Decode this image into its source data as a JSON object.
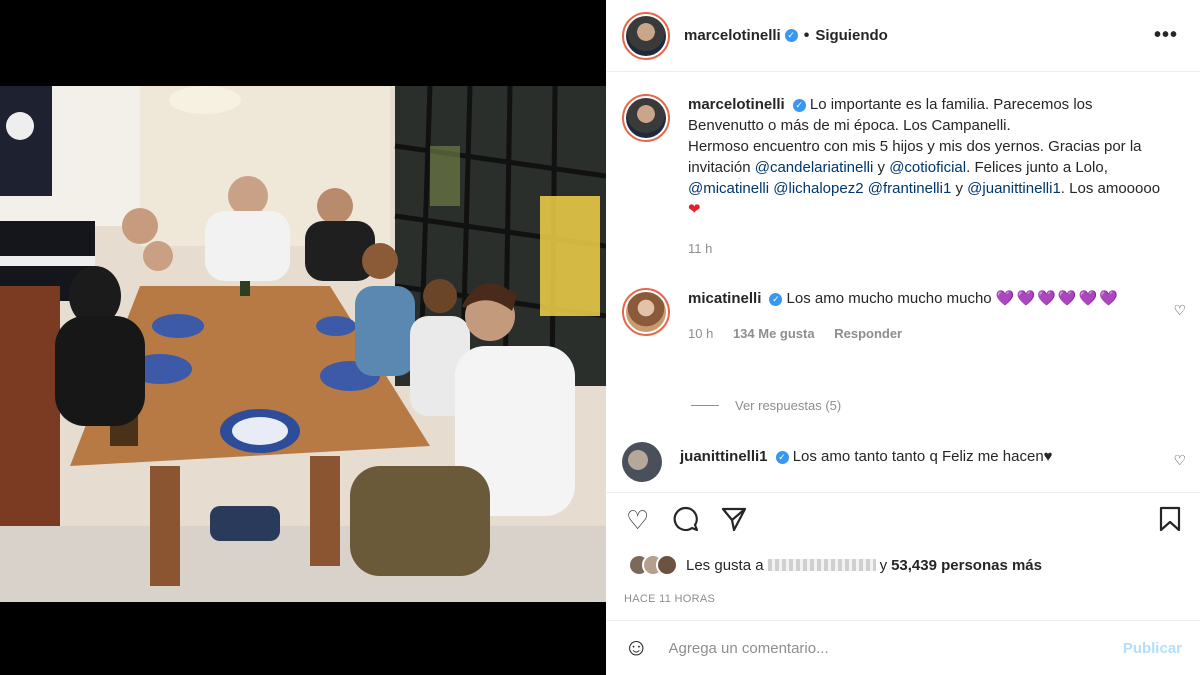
{
  "header": {
    "username": "marcelotinelli",
    "separator": "•",
    "follow_status": "Siguiendo",
    "more": "•••"
  },
  "caption": {
    "username": "marcelotinelli",
    "text1": "Lo importante es la familia. Parecemos los Benvenutto o más de mi época. Los Campanelli.",
    "text2": "Hermoso encuentro con mis 5 hijos y mis dos yernos. Gracias por la invitación",
    "mention1": "@candelariatinelli",
    "y1": "y",
    "mention2": "@cotioficial",
    "text3": ". Felices junto a Lolo,",
    "mention3": "@micatinelli",
    "mention4": "@lichalopez2",
    "mention5": "@frantinelli1",
    "y2": "y",
    "mention6": "@juanittinelli1",
    "text4": ". Los amooooo",
    "emoji": "❤",
    "time": "11 h"
  },
  "comments": [
    {
      "username": "micatinelli",
      "text": "Los amo mucho mucho mucho",
      "hearts": "💜💜💜💜💜💜",
      "time": "10 h",
      "likes": "134 Me gusta",
      "reply": "Responder",
      "view_replies": "Ver respuestas (5)"
    },
    {
      "username": "juanittinelli1",
      "text": "Los amo tanto tanto q Feliz me hacen♥"
    }
  ],
  "actions": {
    "like_icon": "heart-icon",
    "comment_icon": "comment-icon",
    "share_icon": "share-icon",
    "save_icon": "bookmark-icon"
  },
  "likes": {
    "prefix": "Les gusta a",
    "suffix": "y",
    "count_text": "53,439 personas más"
  },
  "timestamp": "HACE 11 HORAS",
  "comment_box": {
    "placeholder": "Agrega un comentario...",
    "publish": "Publicar"
  },
  "colors": {
    "verified": "#3897f0",
    "link": "#00376b",
    "publish_disabled": "#b2dffc"
  }
}
